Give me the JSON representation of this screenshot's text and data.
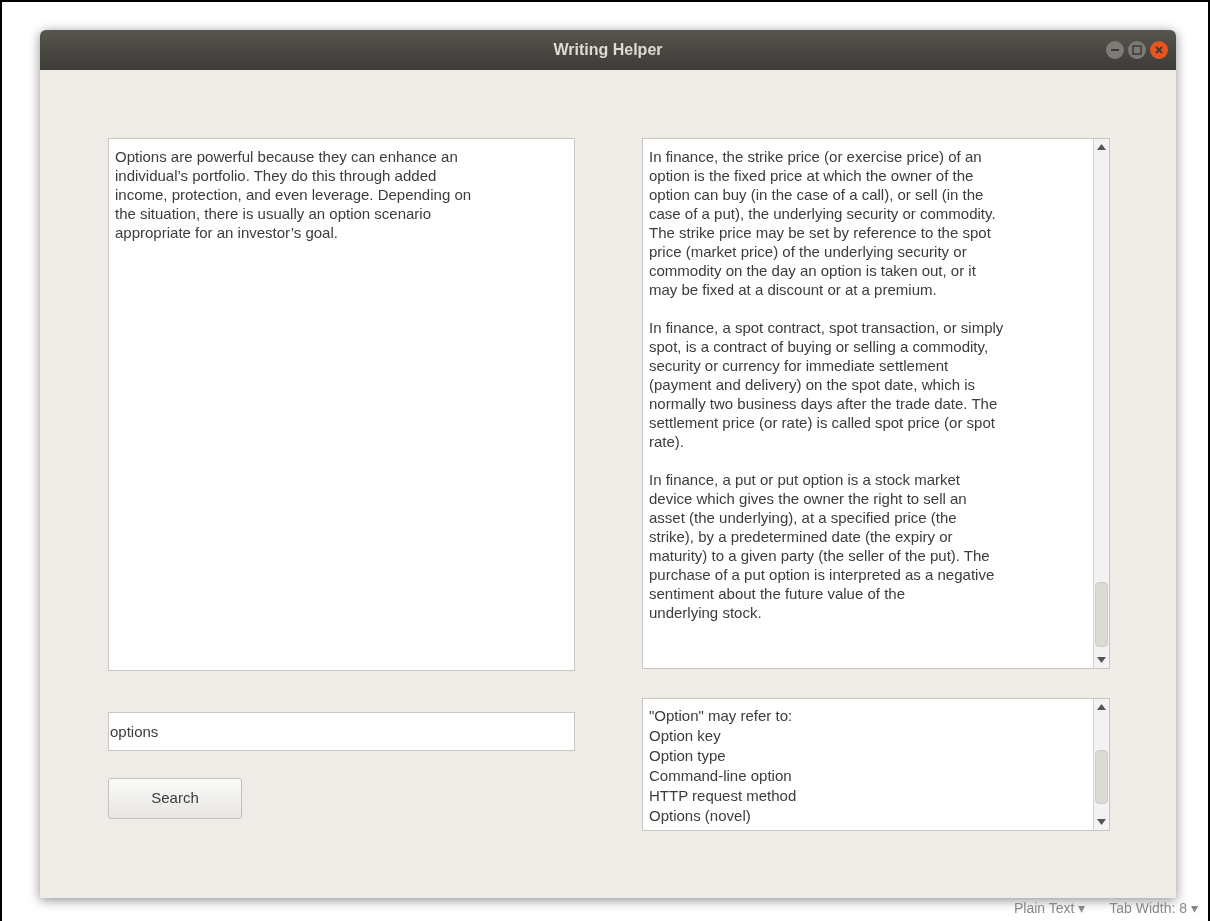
{
  "window": {
    "title": "Writing Helper"
  },
  "draft_text": {
    "lines": [
      "Options are powerful because they can enhance an",
      "individual’s portfolio. They do this through added",
      "income, protection, and even leverage. Depending on",
      "the situation, there is usually an option scenario",
      "appropriate for an investor’s goal."
    ]
  },
  "definitions": {
    "paragraphs": [
      [
        "In finance, the strike price (or exercise price) of an",
        "option is the fixed price at which the owner of the",
        "option can buy (in the case of a call), or sell (in the",
        "case of a put), the underlying security or commodity.",
        "The strike price may be set by reference to the spot",
        "price (market price) of the underlying security or",
        "commodity on the day an option is taken out, or it",
        "may be fixed at a discount or at a premium."
      ],
      [
        "In finance, a spot contract, spot transaction, or simply",
        "spot, is a contract of buying or selling a commodity,",
        "security or currency for immediate settlement",
        "(payment and delivery) on the spot date, which is",
        "normally two business days after the trade date. The",
        "settlement price (or rate) is called spot price (or spot",
        "rate)."
      ],
      [
        "In finance, a put or put option is a stock market",
        "device which gives the owner the right to sell an",
        "asset (the underlying), at a specified price (the",
        "strike), by a predetermined date (the expiry or",
        "maturity) to a given party (the seller of the put). The",
        "purchase of a put option is interpreted as a negative",
        "sentiment about the future value of the",
        "underlying stock."
      ]
    ]
  },
  "search": {
    "value": "options",
    "button": "Search"
  },
  "results": [
    "\"Option\" may refer to:",
    "Option key",
    "Option type",
    "Command-line option",
    "HTTP request method",
    "Options (novel)"
  ],
  "status_bar": [
    "Plain Text ▾",
    "Tab Width: 8 ▾"
  ]
}
